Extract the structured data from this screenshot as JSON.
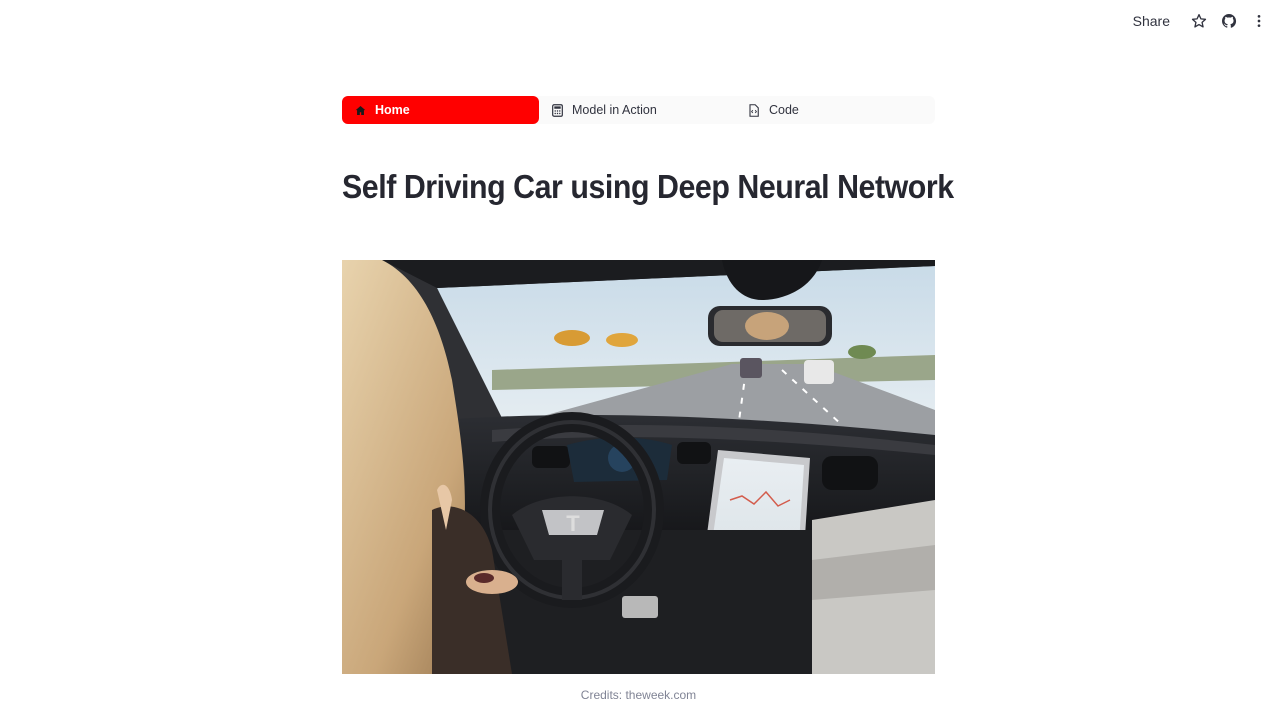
{
  "toolbar": {
    "share_label": "Share",
    "icons": [
      "star-icon",
      "github-icon",
      "more-vertical-icon"
    ]
  },
  "nav": {
    "items": [
      {
        "label": "Home",
        "icon": "house-icon",
        "active": true
      },
      {
        "label": "Model in Action",
        "icon": "calculator-icon",
        "active": false
      },
      {
        "label": "Code",
        "icon": "file-code-icon",
        "active": false
      }
    ]
  },
  "page": {
    "title": "Self Driving Car using Deep Neural Network"
  },
  "image": {
    "caption": "Credits: theweek.com",
    "badge_text": "T"
  },
  "colors": {
    "accent": "#ff0000",
    "text": "#31333f",
    "caption": "#808495"
  }
}
